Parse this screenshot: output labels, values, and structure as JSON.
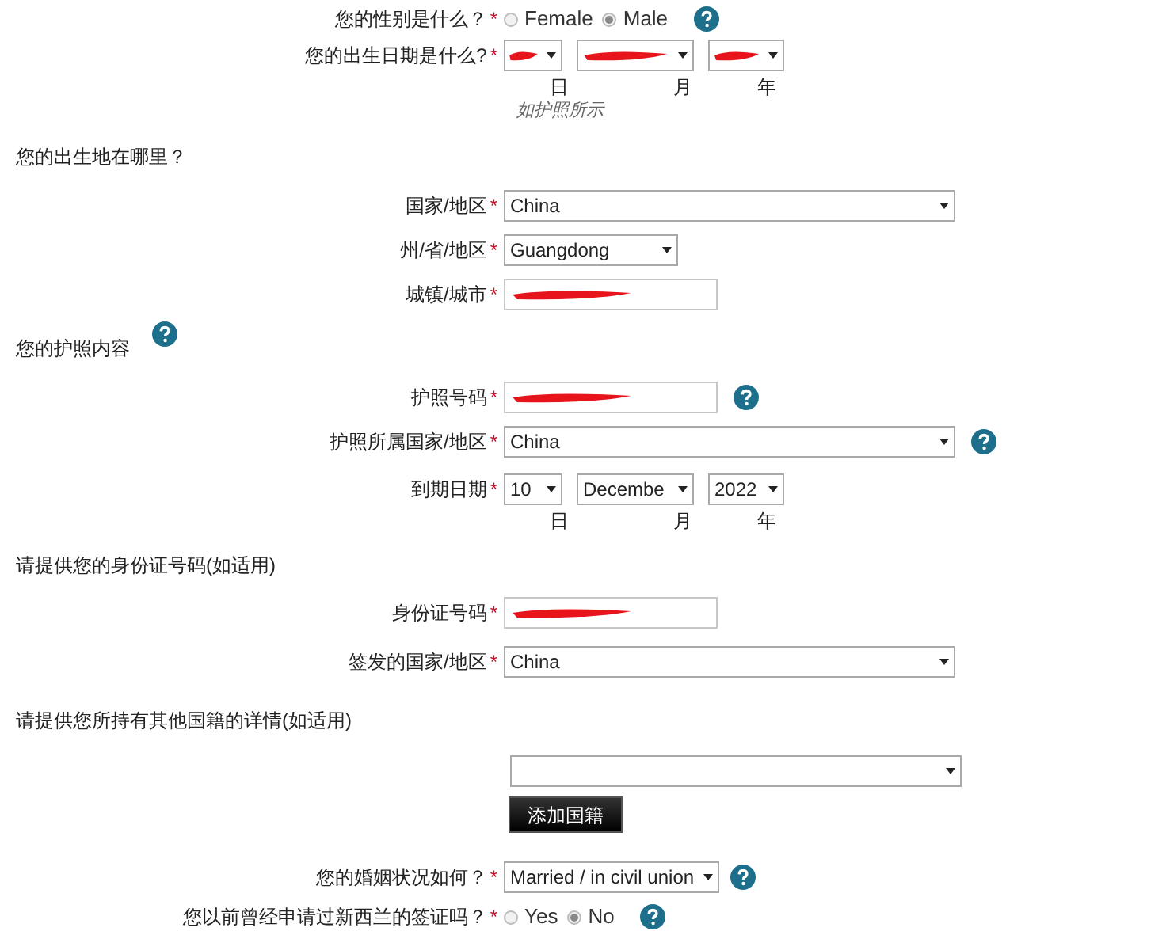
{
  "gender": {
    "label": "您的性别是什么？",
    "required": "*",
    "options": [
      {
        "label": "Female",
        "selected": false
      },
      {
        "label": "Male",
        "selected": true
      }
    ]
  },
  "birth_date": {
    "label": "您的出生日期是什么?",
    "required": "*",
    "day": {
      "redacted": true
    },
    "month": {
      "redacted": true
    },
    "year": {
      "redacted": true
    },
    "units": [
      "日",
      "月",
      "年"
    ],
    "hint": "如护照所示"
  },
  "birthplace": {
    "heading": "您的出生地在哪里？",
    "fields": [
      {
        "kind": "wide-select",
        "label": "国家/地区",
        "required": "*",
        "value": "China",
        "redacted": false,
        "help": false
      },
      {
        "kind": "narrow-select",
        "label": "州/省/地区",
        "required": "*",
        "value": "Guangdong",
        "redacted": false,
        "help": false
      },
      {
        "kind": "input",
        "label": "城镇/城市",
        "required": "*",
        "redacted": true,
        "help": false
      }
    ]
  },
  "passport": {
    "heading": "您的护照内容",
    "fields": [
      {
        "kind": "input",
        "label": "护照号码",
        "required": "*",
        "redacted": true,
        "help": true
      },
      {
        "kind": "wide-select",
        "label": "护照所属国家/地区",
        "required": "*",
        "value": "China",
        "redacted": false,
        "help": true
      }
    ],
    "expiry": {
      "label": "到期日期",
      "required": "*",
      "day": {
        "value": "10",
        "redacted": false
      },
      "month": {
        "value": "Decembe",
        "redacted": false
      },
      "year": {
        "value": "2022",
        "redacted": false
      },
      "units": [
        "日",
        "月",
        "年"
      ]
    }
  },
  "identity": {
    "heading": "请提供您的身份证号码(如适用)",
    "fields": [
      {
        "kind": "input",
        "label": "身份证号码",
        "required": "*",
        "redacted": true,
        "help": false
      },
      {
        "kind": "wide-select",
        "label": "签发的国家/地区",
        "required": "*",
        "value": "China",
        "redacted": false,
        "help": false
      }
    ]
  },
  "other_nationality": {
    "heading": "请提供您所持有其他国籍的详情(如适用)",
    "button": "添加国籍"
  },
  "marital": {
    "label": "您的婚姻状况如何？",
    "required": "*",
    "value": "Married / in civil union"
  },
  "previous_visa": {
    "label": "您以前曾经申请过新西兰的签证吗？",
    "required": "*",
    "options": [
      {
        "label": "Yes",
        "selected": false
      },
      {
        "label": "No",
        "selected": true
      }
    ]
  }
}
